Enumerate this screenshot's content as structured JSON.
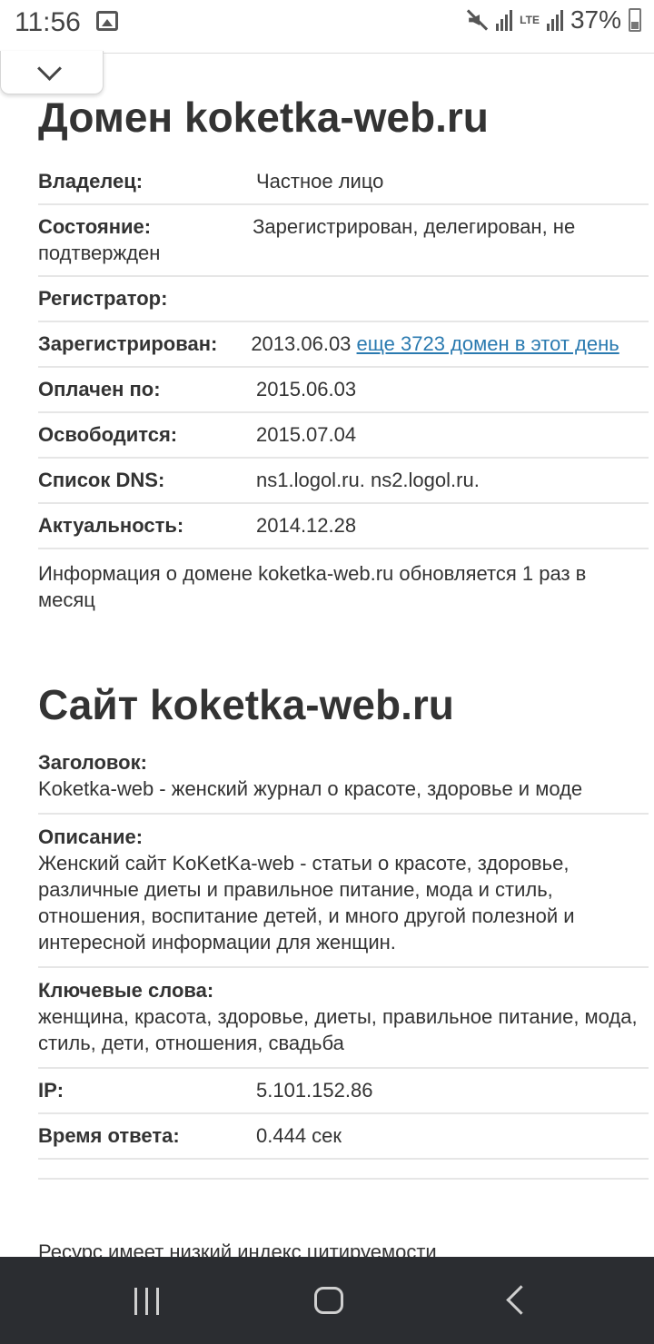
{
  "status_bar": {
    "time": "11:56",
    "network": "LTE",
    "battery": "37%"
  },
  "domain_section": {
    "title": "Домен koketka-web.ru",
    "rows": [
      {
        "label": "Владелец:",
        "value": "Частное лицо"
      },
      {
        "label": "Регистратор:",
        "value": ""
      },
      {
        "label": "Оплачен по:",
        "value": "2015.06.03"
      },
      {
        "label": "Освободится:",
        "value": "2015.07.04"
      },
      {
        "label": "Список DNS:",
        "value": "ns1.logol.ru. ns2.logol.ru."
      },
      {
        "label": "Актуальность:",
        "value": "2014.12.28"
      }
    ],
    "state": {
      "label": "Состояние:",
      "value": "Зарегистрирован, делегирован, не подтвержден"
    },
    "registered": {
      "label": "Зарегистрирован:",
      "date": "2013.06.03",
      "link": "еще 3723 домен в этот день"
    },
    "info": "Информация о домене koketka-web.ru обновляется 1 раз в месяц"
  },
  "site_section": {
    "title": "Сайт koketka-web.ru",
    "heading": {
      "label": "Заголовок:",
      "value": "Koketka-web - женский журнал о красоте, здоровье и моде"
    },
    "description": {
      "label": "Описание:",
      "value": "Женский сайт KoKetKa-web - статьи о красоте, здоровье, различные диеты и правильное питание, мода и стиль, отношения, воспитание детей, и много другой полезной и интересной информации для женщин."
    },
    "keywords": {
      "label": "Ключевые слова:",
      "value": "женщина, красота, здоровье, диеты, правильное питание, мода, стиль, дети, отношения, свадьба"
    },
    "ip": {
      "label": "IP:",
      "value": "5.101.152.86"
    },
    "response": {
      "label": "Время ответа:",
      "value": "0.444 сек"
    },
    "cut_text": "Ресурс имеет низкий индекс цитируемости"
  },
  "icons": [
    "image-icon",
    "mute-icon",
    "signal-icon",
    "battery-icon",
    "chevron-down-icon",
    "recent-apps-icon",
    "home-icon",
    "back-icon"
  ]
}
